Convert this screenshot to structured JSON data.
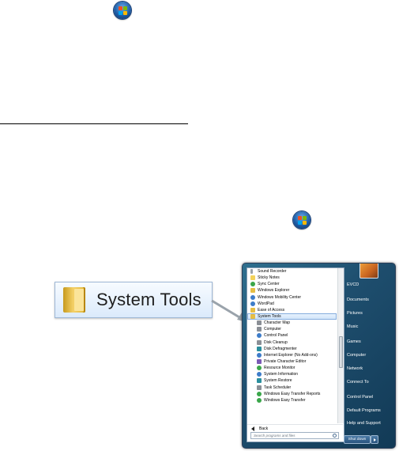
{
  "callout": {
    "label": "System Tools"
  },
  "start_menu": {
    "programs": [
      {
        "label": "Sound Recorder",
        "icon": "microphone-icon",
        "sub": false
      },
      {
        "label": "Sticky Notes",
        "icon": "sticky-notes-icon",
        "sub": false
      },
      {
        "label": "Sync Center",
        "icon": "sync-icon",
        "sub": false
      },
      {
        "label": "Windows Explorer",
        "icon": "explorer-icon",
        "sub": false
      },
      {
        "label": "Windows Mobility Center",
        "icon": "mobility-icon",
        "sub": false
      },
      {
        "label": "WordPad",
        "icon": "wordpad-icon",
        "sub": false
      },
      {
        "label": "Ease of Access",
        "icon": "folder-icon",
        "sub": false
      },
      {
        "label": "System Tools",
        "icon": "folder-icon",
        "sub": false,
        "highlighted": true
      },
      {
        "label": "Character Map",
        "icon": "character-map-icon",
        "sub": true
      },
      {
        "label": "Computer",
        "icon": "computer-icon",
        "sub": true
      },
      {
        "label": "Control Panel",
        "icon": "control-panel-icon",
        "sub": true
      },
      {
        "label": "Disk Cleanup",
        "icon": "disk-cleanup-icon",
        "sub": true
      },
      {
        "label": "Disk Defragmenter",
        "icon": "defragmenter-icon",
        "sub": true
      },
      {
        "label": "Internet Explorer (No Add-ons)",
        "icon": "internet-explorer-icon",
        "sub": true
      },
      {
        "label": "Private Character Editor",
        "icon": "character-editor-icon",
        "sub": true
      },
      {
        "label": "Resource Monitor",
        "icon": "resource-monitor-icon",
        "sub": true
      },
      {
        "label": "System Information",
        "icon": "system-information-icon",
        "sub": true
      },
      {
        "label": "System Restore",
        "icon": "system-restore-icon",
        "sub": true
      },
      {
        "label": "Task Scheduler",
        "icon": "task-scheduler-icon",
        "sub": true
      },
      {
        "label": "Windows Easy Transfer Reports",
        "icon": "easy-transfer-icon",
        "sub": true
      },
      {
        "label": "Windows Easy Transfer",
        "icon": "easy-transfer-icon",
        "sub": true
      }
    ],
    "back_label": "Back",
    "search_placeholder": "Search programs and files",
    "right_items": [
      "EVCD",
      "Documents",
      "Pictures",
      "Music",
      "Games",
      "Computer",
      "Network",
      "Connect To",
      "Control Panel",
      "Default Programs",
      "Help and Support"
    ],
    "shutdown_label": "Shut down"
  }
}
